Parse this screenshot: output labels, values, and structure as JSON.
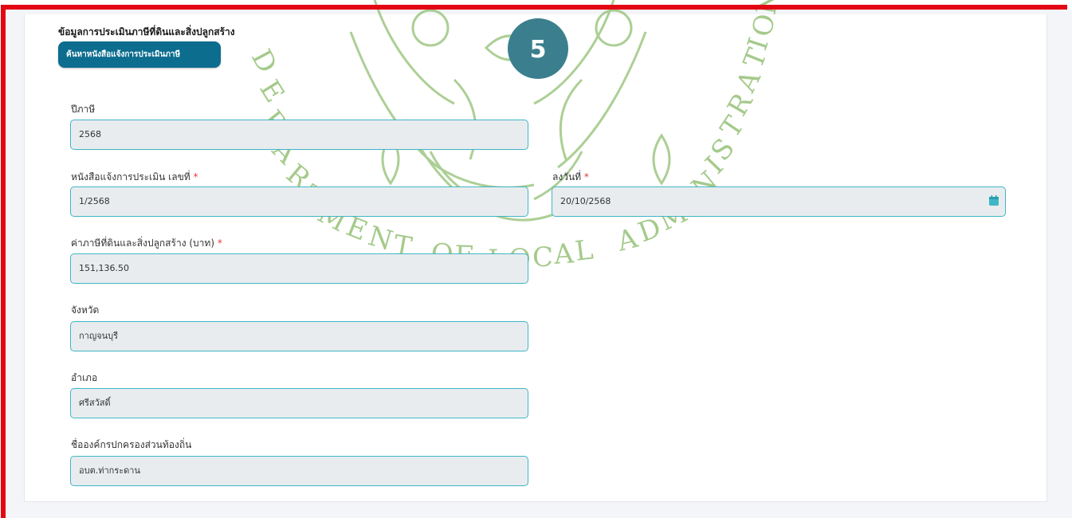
{
  "section": {
    "title": "ข้อมูลการประเมินภาษีที่ดินและสิ่งปลูกสร้าง",
    "search_button": "ค้นหาหนังสือแจ้งการประเมินภาษี"
  },
  "step_badge": "5",
  "watermark_text": "DEPARTMENT OF LOCAL ADMINISTRATION",
  "form": {
    "tax_year": {
      "label": "ปีภาษี",
      "value": "2568"
    },
    "notice_number": {
      "label": "หนังสือแจ้งการประเมิน เลขที่",
      "required": "*",
      "value": "1/2568"
    },
    "notice_date": {
      "label": "ลงวันที่",
      "required": "*",
      "value": "20/10/2568",
      "icon": "calendar-icon"
    },
    "tax_amount": {
      "label": "ค่าภาษีที่ดินและสิ่งปลูกสร้าง (บาท)",
      "required": "*",
      "value": "151,136.50"
    },
    "province": {
      "label": "จังหวัด",
      "value": "กาญจนบุรี"
    },
    "district": {
      "label": "อำเภอ",
      "value": "ศรีสวัสดิ์"
    },
    "local_org": {
      "label": "ชื่อองค์กรปกครองส่วนท้องถิ่น",
      "value": "อบต.ท่ากระดาน"
    }
  },
  "colors": {
    "frame_border": "#e30613",
    "button_bg": "#0c6d8f",
    "field_border": "#3fb6c6",
    "field_bg": "#e9ecef",
    "badge_bg": "#3b7f8e",
    "watermark": "#4f9a2f"
  }
}
